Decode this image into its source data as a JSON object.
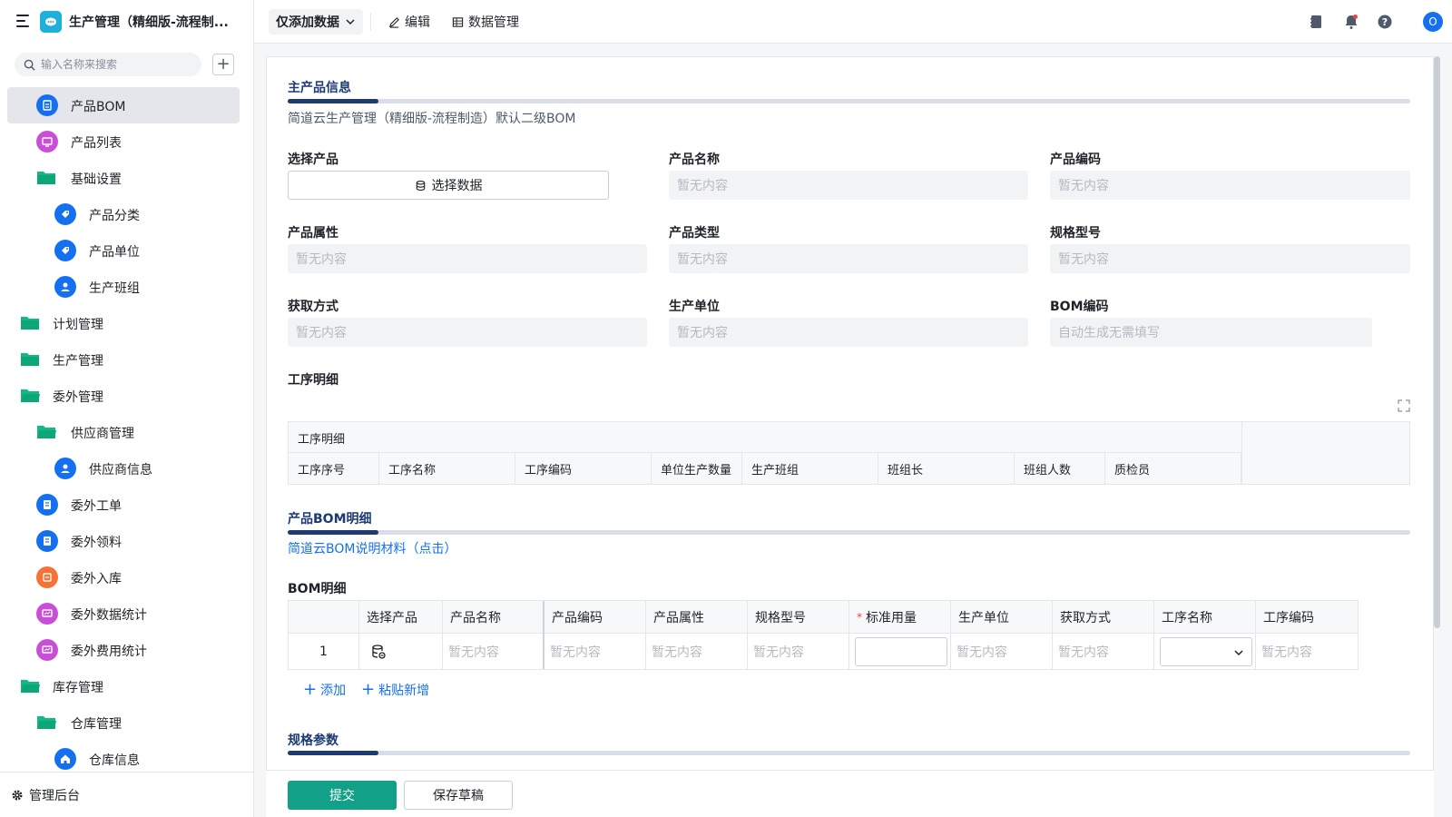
{
  "app": {
    "title": "生产管理（精细版-流程制...",
    "logo_color": "#1fb0d9"
  },
  "sidebar": {
    "search_placeholder": "输入名称来搜索",
    "items": [
      {
        "label": "产品BOM",
        "icon": "bom-icon",
        "color": "#1570ef",
        "active": true
      },
      {
        "label": "产品列表",
        "icon": "list-icon",
        "color": "#c94fd8"
      },
      {
        "label": "基础设置",
        "icon": "folder-icon",
        "color": "#12b886"
      },
      {
        "label": "产品分类",
        "icon": "tag-icon",
        "color": "#1570ef"
      },
      {
        "label": "产品单位",
        "icon": "tag-icon",
        "color": "#1570ef"
      },
      {
        "label": "生产班组",
        "icon": "user-icon",
        "color": "#1570ef"
      },
      {
        "label": "计划管理",
        "icon": "folder-icon",
        "color": "#12b886"
      },
      {
        "label": "生产管理",
        "icon": "folder-icon",
        "color": "#12b886"
      },
      {
        "label": "委外管理",
        "icon": "folder-icon",
        "color": "#12b886"
      },
      {
        "label": "供应商管理",
        "icon": "folder-icon",
        "color": "#12b886"
      },
      {
        "label": "供应商信息",
        "icon": "user-icon",
        "color": "#1570ef"
      },
      {
        "label": "委外工单",
        "icon": "doc-icon",
        "color": "#1570ef"
      },
      {
        "label": "委外领料",
        "icon": "doc-icon",
        "color": "#1570ef"
      },
      {
        "label": "委外入库",
        "icon": "box-icon",
        "color": "#f77234"
      },
      {
        "label": "委外数据统计",
        "icon": "chart-icon",
        "color": "#c94fd8"
      },
      {
        "label": "委外费用统计",
        "icon": "chart-icon",
        "color": "#c94fd8"
      },
      {
        "label": "库存管理",
        "icon": "folder-icon",
        "color": "#12b886"
      },
      {
        "label": "仓库管理",
        "icon": "folder-icon",
        "color": "#12b886"
      },
      {
        "label": "仓库信息",
        "icon": "home-icon",
        "color": "#1570ef"
      }
    ],
    "footer_label": "管理后台"
  },
  "toolbar": {
    "filter_label": "仅添加数据",
    "edit_label": "编辑",
    "data_mgmt_label": "数据管理",
    "avatar_letter": "O"
  },
  "main_product": {
    "title": "主产品信息",
    "desc": "简道云生产管理（精细版-流程制造）默认二级BOM",
    "fields": {
      "select_product": {
        "label": "选择产品",
        "button": "选择数据"
      },
      "product_name": {
        "label": "产品名称",
        "value": "暂无内容"
      },
      "product_code": {
        "label": "产品编码",
        "value": "暂无内容"
      },
      "product_attr": {
        "label": "产品属性",
        "value": "暂无内容"
      },
      "product_type": {
        "label": "产品类型",
        "value": "暂无内容"
      },
      "spec_model": {
        "label": "规格型号",
        "value": "暂无内容"
      },
      "acquire_method": {
        "label": "获取方式",
        "value": "暂无内容"
      },
      "prod_unit": {
        "label": "生产单位",
        "value": "暂无内容"
      },
      "bom_code": {
        "label": "BOM编码",
        "value": "自动生成无需填写"
      }
    }
  },
  "process": {
    "label": "工序明细",
    "table_caption": "工序明细",
    "columns": [
      "工序序号",
      "工序名称",
      "工序编码",
      "单位生产数量",
      "生产班组",
      "班组长",
      "班组人数",
      "质检员"
    ]
  },
  "bom_section": {
    "title": "产品BOM明细",
    "link": "简道云BOM说明材料（点击）",
    "table_label": "BOM明细",
    "columns": [
      "选择产品",
      "产品名称",
      "产品编码",
      "产品属性",
      "规格型号",
      "标准用量",
      "生产单位",
      "获取方式",
      "工序名称",
      "工序编码"
    ],
    "row": {
      "index": "1",
      "product_name": "暂无内容",
      "product_code": "暂无内容",
      "product_attr": "暂无内容",
      "spec_model": "暂无内容",
      "prod_unit": "暂无内容",
      "acquire_method": "暂无内容",
      "process_code": "暂无内容"
    },
    "add_label": "添加",
    "paste_label": "粘贴新增"
  },
  "spec_section": {
    "title": "规格参数"
  },
  "actions": {
    "submit": "提交",
    "save_draft": "保存草稿"
  },
  "colors": {
    "accent": "#13a088",
    "section": "#1d3a74",
    "link": "#1570ef"
  }
}
